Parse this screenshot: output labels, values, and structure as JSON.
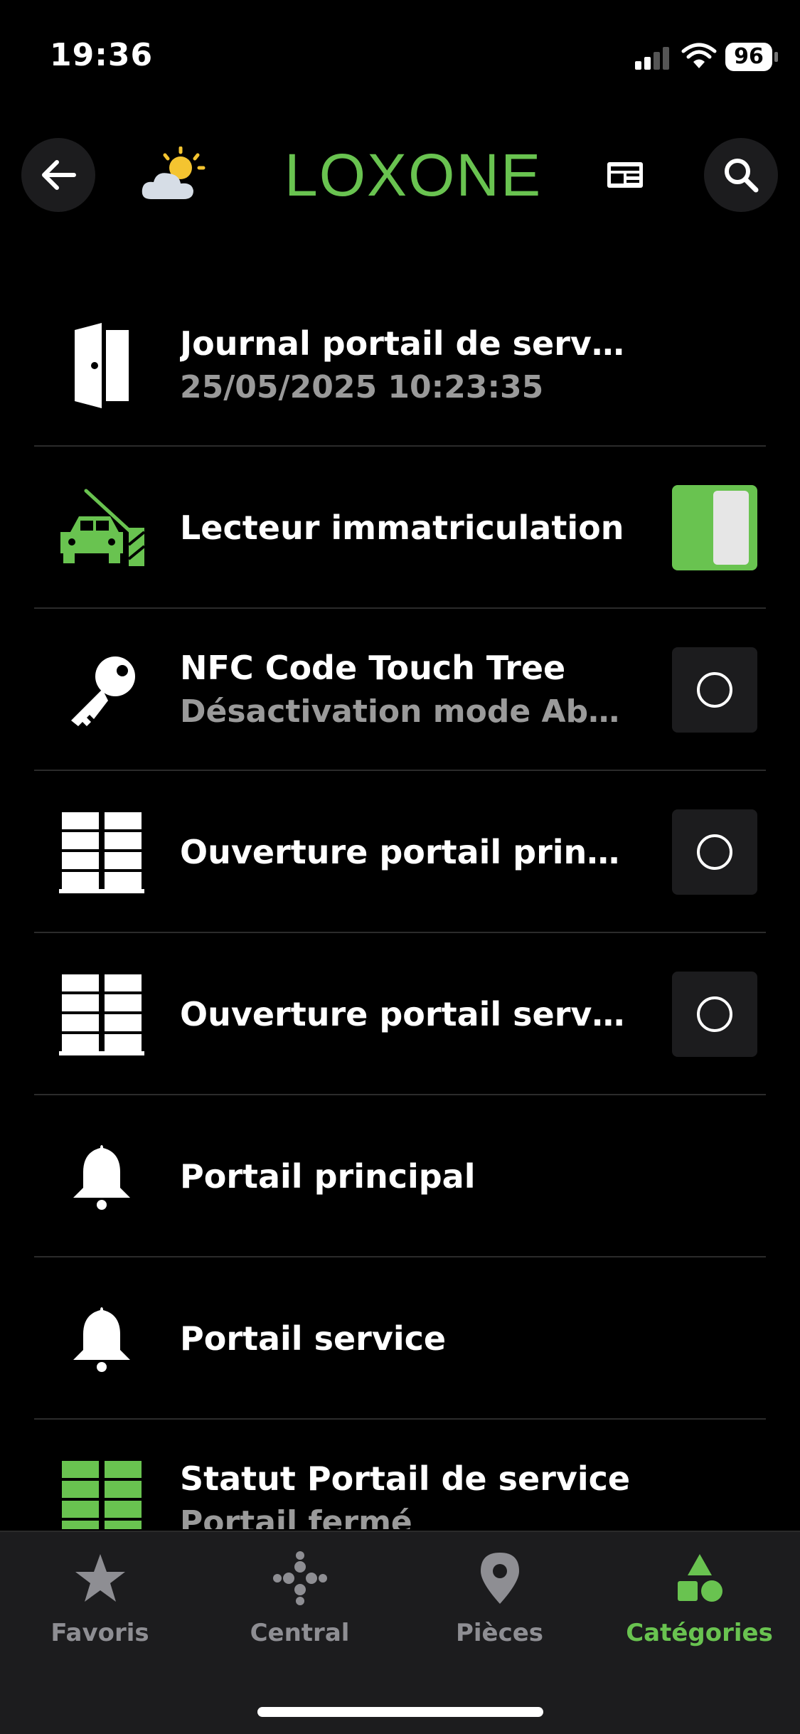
{
  "status_bar": {
    "time": "19:36",
    "battery": "96"
  },
  "header": {
    "brand": "LOXONE"
  },
  "items": [
    {
      "title": "Journal portail de service",
      "subtitle": "25/05/2025 10:23:35",
      "icon": "door-icon",
      "action": "none"
    },
    {
      "title": "Lecteur immatriculation",
      "subtitle": "",
      "icon": "car-barrier-icon",
      "action": "toggle-on"
    },
    {
      "title": "NFC Code Touch Tree",
      "subtitle": "Désactivation mode Abs...",
      "icon": "key-icon",
      "action": "push-button"
    },
    {
      "title": "Ouverture portail princip...",
      "subtitle": "",
      "icon": "gate-icon",
      "action": "push-button"
    },
    {
      "title": "Ouverture portail service",
      "subtitle": "",
      "icon": "gate-icon",
      "action": "push-button"
    },
    {
      "title": "Portail principal",
      "subtitle": "",
      "icon": "bell-icon",
      "action": "none"
    },
    {
      "title": "Portail service",
      "subtitle": "",
      "icon": "bell-icon",
      "action": "none"
    },
    {
      "title": "Statut Portail de service",
      "subtitle": "Portail fermé",
      "icon": "gate-green-icon",
      "action": "none"
    }
  ],
  "tabs": [
    {
      "label": "Favoris",
      "icon": "star-icon",
      "active": false
    },
    {
      "label": "Central",
      "icon": "central-dots-icon",
      "active": false
    },
    {
      "label": "Pièces",
      "icon": "location-pin-icon",
      "active": false
    },
    {
      "label": "Catégories",
      "icon": "categories-shapes-icon",
      "active": true
    }
  ],
  "colors": {
    "accent": "#69c350",
    "background": "#000000",
    "tab_bar": "#1c1c1e",
    "inactive": "#8e8e93"
  }
}
